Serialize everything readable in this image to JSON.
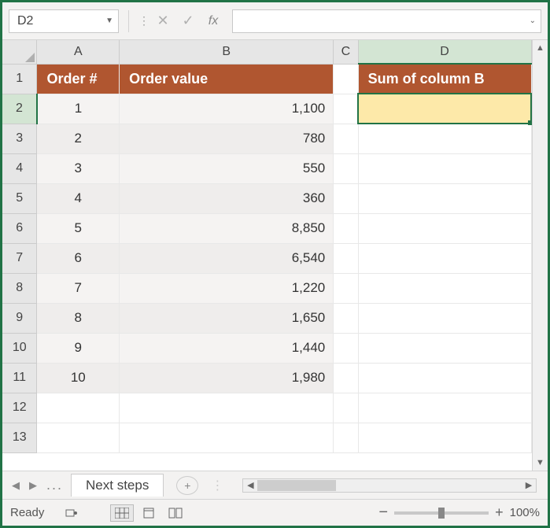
{
  "name_box": "D2",
  "fx_label": "fx",
  "columns": [
    "A",
    "B",
    "C",
    "D"
  ],
  "rows": [
    "1",
    "2",
    "3",
    "4",
    "5",
    "6",
    "7",
    "8",
    "9",
    "10",
    "11",
    "12",
    "13"
  ],
  "active_col": "D",
  "active_row": "2",
  "headers": {
    "a": "Order #",
    "b": "Order value",
    "d": "Sum of column B"
  },
  "data": [
    {
      "a": "1",
      "b": "1,100"
    },
    {
      "a": "2",
      "b": "780"
    },
    {
      "a": "3",
      "b": "550"
    },
    {
      "a": "4",
      "b": "360"
    },
    {
      "a": "5",
      "b": "8,850"
    },
    {
      "a": "6",
      "b": "6,540"
    },
    {
      "a": "7",
      "b": "1,220"
    },
    {
      "a": "8",
      "b": "1,650"
    },
    {
      "a": "9",
      "b": "1,440"
    },
    {
      "a": "10",
      "b": "1,980"
    }
  ],
  "tab_name": "Next steps",
  "status_text": "Ready",
  "zoom": "100%"
}
